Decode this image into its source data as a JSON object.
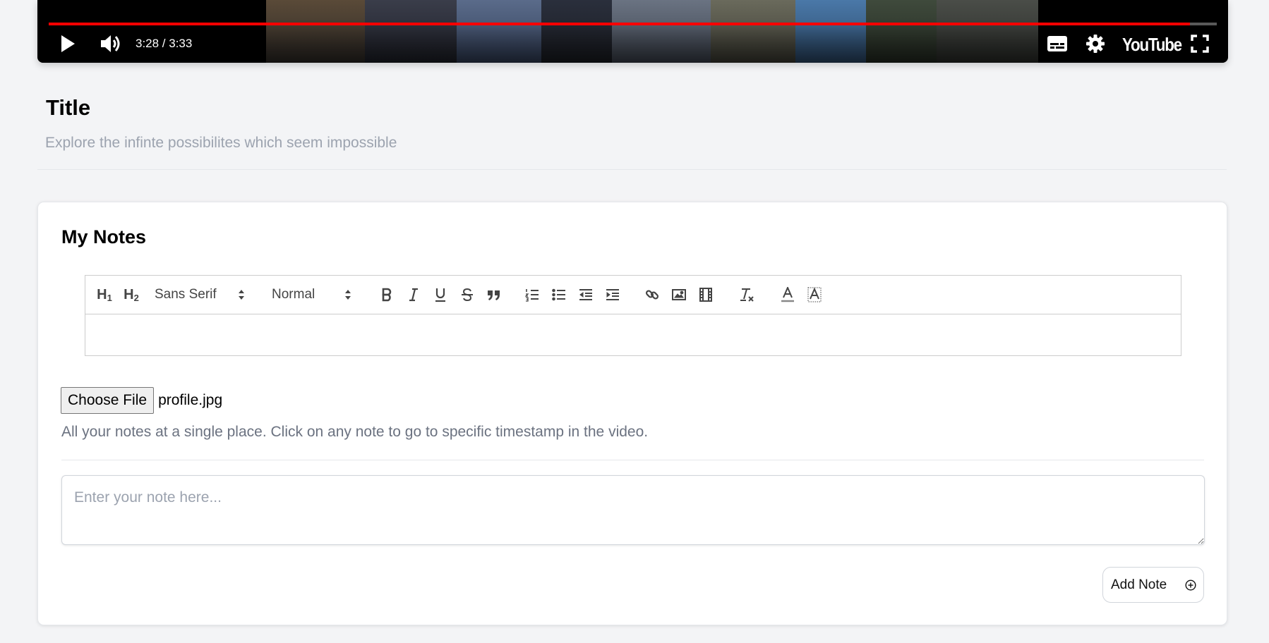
{
  "player": {
    "time_display": "3:28 / 3:33",
    "progress_fraction": 0.977,
    "logo_text": "YouTube",
    "accent_color": "#ff0000",
    "controls": {
      "play": "play-icon",
      "volume": "volume-icon",
      "captions": "subtitles-icon",
      "settings": "gear-icon",
      "fullscreen": "fullscreen-icon"
    }
  },
  "video": {
    "title": "Title",
    "description": "Explore the infinte possibilites which seem impossible"
  },
  "notes": {
    "heading": "My Notes",
    "editor": {
      "font_select": "Sans Serif",
      "size_select": "Normal",
      "toolbar_icons": [
        "heading-1-icon",
        "heading-2-icon",
        "bold-icon",
        "italic-icon",
        "underline-icon",
        "strike-icon",
        "blockquote-icon",
        "ordered-list-icon",
        "bullet-list-icon",
        "outdent-icon",
        "indent-icon",
        "link-icon",
        "image-icon",
        "video-icon",
        "clear-format-icon",
        "text-color-icon",
        "background-color-icon"
      ],
      "content": ""
    },
    "file_input": {
      "button_label": "Choose File",
      "file_name": "profile.jpg"
    },
    "help_text": "All your notes at a single place. Click on any note to go to specific timestamp in the video.",
    "note_input": {
      "placeholder": "Enter your note here...",
      "value": ""
    },
    "add_button_label": "Add Note"
  }
}
